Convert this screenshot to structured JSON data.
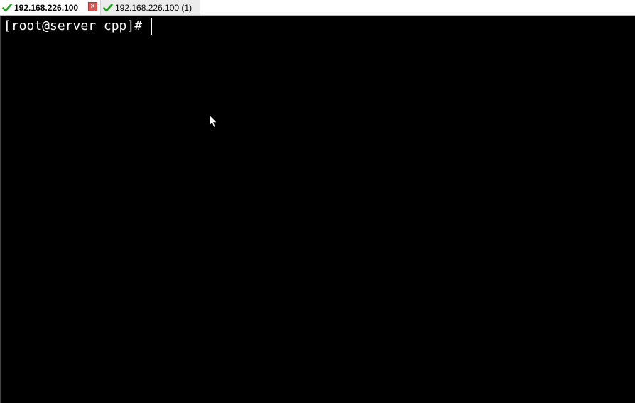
{
  "tabs": [
    {
      "label": "192.168.226.100",
      "active": true,
      "status_icon": "check-icon",
      "status_color": "#1aa31a"
    },
    {
      "label": "192.168.226.100 (1)",
      "active": false,
      "status_icon": "check-icon",
      "status_color": "#1aa31a"
    }
  ],
  "tab_close_icon": "×",
  "terminal": {
    "prompt": "[root@server cpp]#",
    "background": "#000000",
    "foreground": "#ffffff"
  }
}
